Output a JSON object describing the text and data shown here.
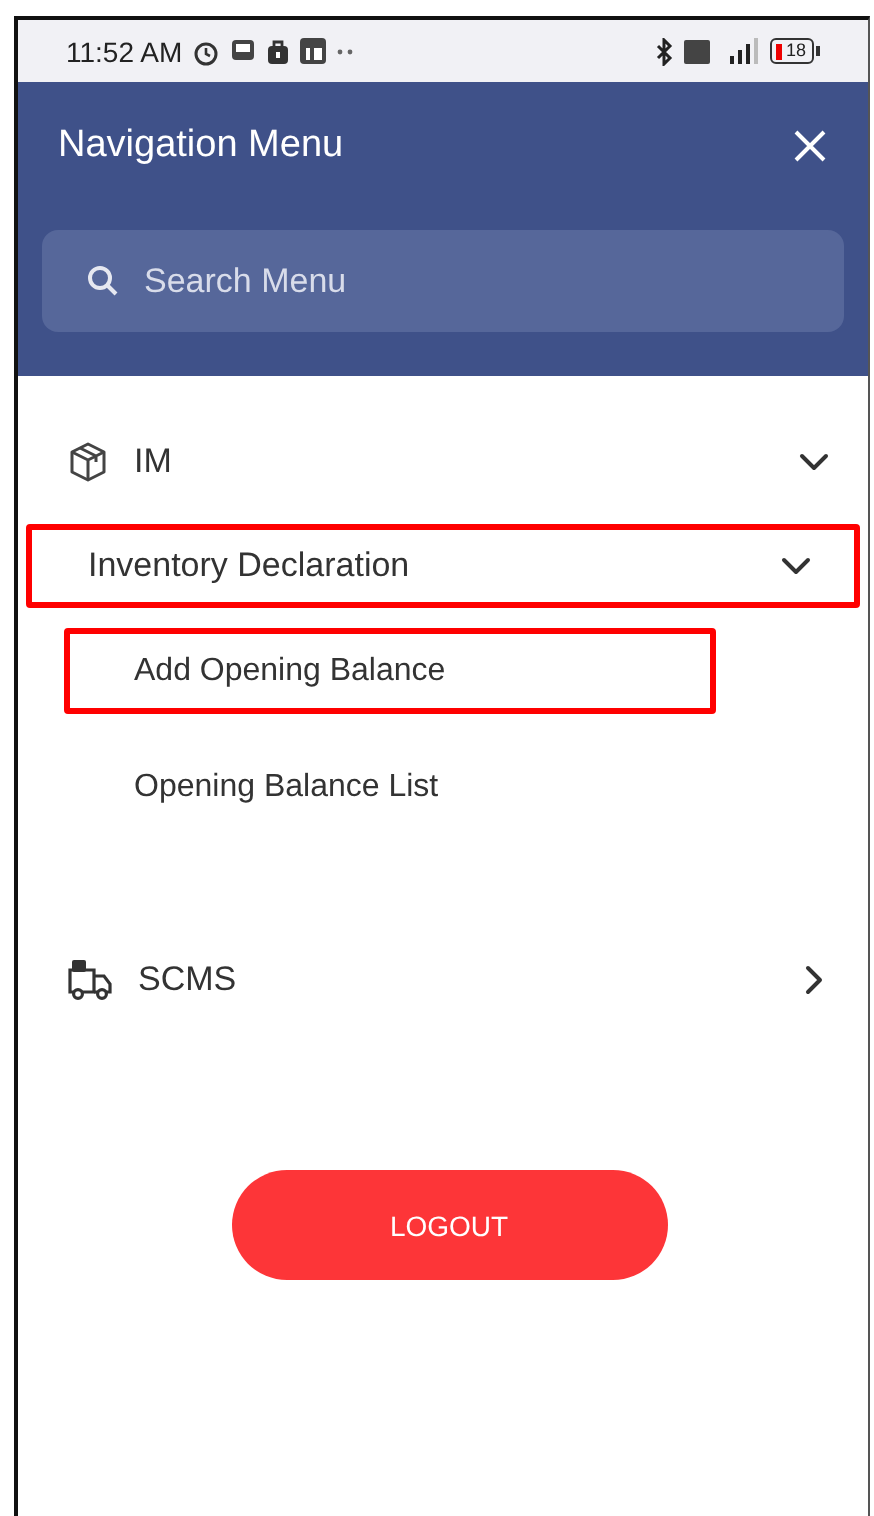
{
  "status_bar": {
    "time": "11:52 AM",
    "battery": "18"
  },
  "header": {
    "title": "Navigation Menu"
  },
  "search": {
    "placeholder": "Search Menu"
  },
  "menu": [
    {
      "label": "IM",
      "kind": "module",
      "expanded": true,
      "children": [
        {
          "label": "Inventory Declaration",
          "kind": "section",
          "expanded": true,
          "highlighted": true,
          "children": [
            {
              "label": "Add Opening Balance",
              "kind": "link",
              "highlighted": true
            },
            {
              "label": "Opening Balance List",
              "kind": "link",
              "highlighted": false
            }
          ]
        }
      ]
    },
    {
      "label": "SCMS",
      "kind": "module",
      "expanded": false
    }
  ],
  "logout": {
    "label": "LOGOUT"
  }
}
